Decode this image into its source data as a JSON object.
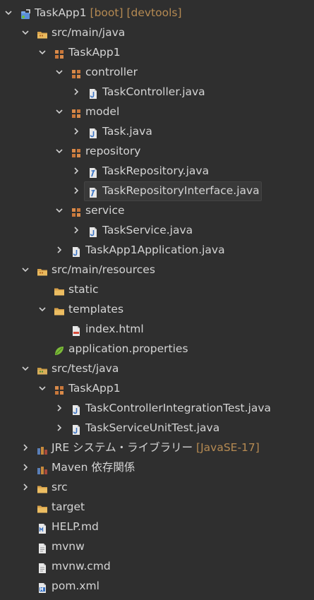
{
  "tree": [
    {
      "label": "TaskApp1",
      "deco": " [boot] [devtools]",
      "level": 0,
      "arrow": "down",
      "icon": "project-icon"
    },
    {
      "label": "src/main/java",
      "level": 1,
      "arrow": "down",
      "icon": "source-folder-icon"
    },
    {
      "label": "TaskApp1",
      "level": 2,
      "arrow": "down",
      "icon": "package-icon"
    },
    {
      "label": "controller",
      "level": 3,
      "arrow": "down",
      "icon": "package-icon"
    },
    {
      "label": "TaskController.java",
      "level": 4,
      "arrow": "right",
      "icon": "java-file-icon"
    },
    {
      "label": "model",
      "level": 3,
      "arrow": "down",
      "icon": "package-icon"
    },
    {
      "label": "Task.java",
      "level": 4,
      "arrow": "right",
      "icon": "java-file-icon"
    },
    {
      "label": "repository",
      "level": 3,
      "arrow": "down",
      "icon": "package-icon"
    },
    {
      "label": "TaskRepository.java",
      "level": 4,
      "arrow": "right",
      "icon": "java-interface-file-icon"
    },
    {
      "label": "TaskRepositoryInterface.java",
      "level": 4,
      "arrow": "right",
      "icon": "java-interface-file-icon",
      "selected": true
    },
    {
      "label": "service",
      "level": 3,
      "arrow": "down",
      "icon": "package-icon"
    },
    {
      "label": "TaskService.java",
      "level": 4,
      "arrow": "right",
      "icon": "java-file-icon"
    },
    {
      "label": "TaskApp1Application.java",
      "level": 3,
      "arrow": "right",
      "icon": "java-file-icon"
    },
    {
      "label": "src/main/resources",
      "level": 1,
      "arrow": "down",
      "icon": "source-folder-icon"
    },
    {
      "label": "static",
      "level": 2,
      "arrow": "none",
      "icon": "folder-icon"
    },
    {
      "label": "templates",
      "level": 2,
      "arrow": "down",
      "icon": "folder-icon"
    },
    {
      "label": "index.html",
      "level": 3,
      "arrow": "none",
      "icon": "html-file-icon"
    },
    {
      "label": "application.properties",
      "level": 2,
      "arrow": "none",
      "icon": "spring-leaf-icon"
    },
    {
      "label": "src/test/java",
      "level": 1,
      "arrow": "down",
      "icon": "test-source-folder-icon"
    },
    {
      "label": "TaskApp1",
      "level": 2,
      "arrow": "down",
      "icon": "package-icon"
    },
    {
      "label": "TaskControllerIntegrationTest.java",
      "level": 3,
      "arrow": "right",
      "icon": "java-file-icon"
    },
    {
      "label": "TaskServiceUnitTest.java",
      "level": 3,
      "arrow": "right",
      "icon": "java-file-icon"
    },
    {
      "label": "JRE システム・ライブラリー",
      "deco": " [JavaSE-17]",
      "level": 1,
      "arrow": "right",
      "icon": "library-icon"
    },
    {
      "label": "Maven 依存関係",
      "level": 1,
      "arrow": "right",
      "icon": "library-icon"
    },
    {
      "label": "src",
      "level": 1,
      "arrow": "right",
      "icon": "folder-icon"
    },
    {
      "label": "target",
      "level": 1,
      "arrow": "none",
      "icon": "folder-icon"
    },
    {
      "label": "HELP.md",
      "level": 1,
      "arrow": "none",
      "icon": "markdown-file-icon"
    },
    {
      "label": "mvnw",
      "level": 1,
      "arrow": "none",
      "icon": "text-file-icon"
    },
    {
      "label": "mvnw.cmd",
      "level": 1,
      "arrow": "none",
      "icon": "text-file-icon"
    },
    {
      "label": "pom.xml",
      "level": 1,
      "arrow": "none",
      "icon": "maven-pom-icon"
    }
  ]
}
